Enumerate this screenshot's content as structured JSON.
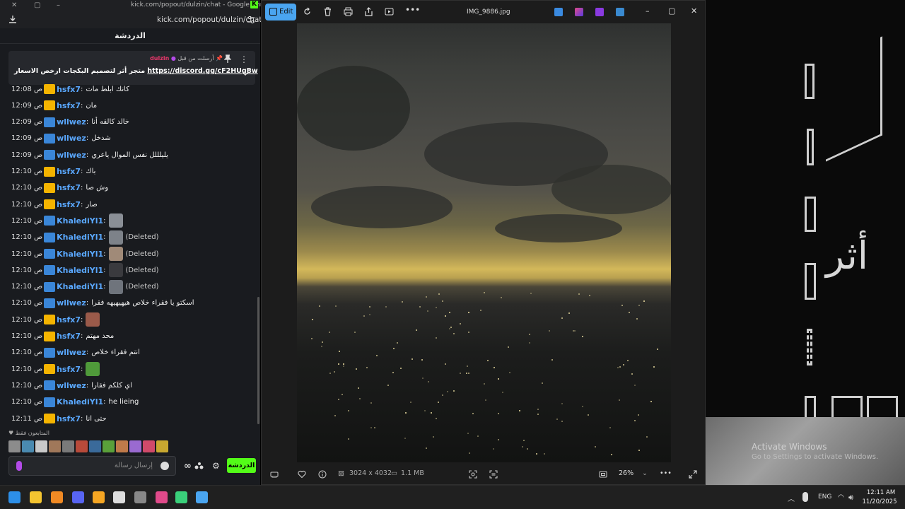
{
  "chrome": {
    "window_title": "kick.com/popout/dulzin/chat - Google Chrome",
    "address": "kick.com/popout/dulzin/chat",
    "logo_letter": "K"
  },
  "chat": {
    "header": "الدردشة",
    "pinned": {
      "author": "dulzin",
      "sent_by_label": "أرسلت من قبل",
      "message_text": "متجر أثر لتصميم البكجات ارخص الاسعار",
      "link": "https://discord.gg/cF2HUgBw"
    },
    "messages": [
      {
        "time": "12:08 ص",
        "user": "hsfx7",
        "badge": "crown",
        "color": "#5aa8ff",
        "text": "كانك ابلط مات",
        "emote": "",
        "deleted": ""
      },
      {
        "time": "12:09 ص",
        "user": "hsfx7",
        "badge": "crown",
        "color": "#5aa8ff",
        "text": "مان",
        "emote": "",
        "deleted": ""
      },
      {
        "time": "12:09 ص",
        "user": "wllwez",
        "badge": "sub",
        "color": "#5aa8ff",
        "text": "خالد كالقه أنا",
        "emote": "",
        "deleted": ""
      },
      {
        "time": "12:09 ص",
        "user": "wllwez",
        "badge": "sub",
        "color": "#5aa8ff",
        "text": "شدخل",
        "emote": "",
        "deleted": ""
      },
      {
        "time": "12:09 ص",
        "user": "wllwez",
        "badge": "sub",
        "color": "#5aa8ff",
        "text": "يليلللل نفس الموال ياعري",
        "emote": "",
        "deleted": ""
      },
      {
        "time": "12:10 ص",
        "user": "hsfx7",
        "badge": "crown",
        "color": "#5aa8ff",
        "text": "باك",
        "emote": "",
        "deleted": ""
      },
      {
        "time": "12:10 ص",
        "user": "hsfx7",
        "badge": "crown",
        "color": "#5aa8ff",
        "text": "وش صا",
        "emote": "",
        "deleted": ""
      },
      {
        "time": "12:10 ص",
        "user": "hsfx7",
        "badge": "crown",
        "color": "#5aa8ff",
        "text": "صار",
        "emote": "",
        "deleted": ""
      },
      {
        "time": "12:10 ص",
        "user": "KhalediYl1",
        "badge": "sub",
        "color": "#5aa8ff",
        "text": "",
        "emote": "#8a8f96",
        "deleted": ""
      },
      {
        "time": "12:10 ص",
        "user": "KhalediYl1",
        "badge": "sub",
        "color": "#5aa8ff",
        "text": "",
        "emote": "#7d8289",
        "deleted": "(Deleted)"
      },
      {
        "time": "12:10 ص",
        "user": "KhalediYl1",
        "badge": "sub",
        "color": "#5aa8ff",
        "text": "",
        "emote": "#a08a78",
        "deleted": "(Deleted)"
      },
      {
        "time": "12:10 ص",
        "user": "KhalediYl1",
        "badge": "sub",
        "color": "#5aa8ff",
        "text": "",
        "emote": "#3a3a3e",
        "deleted": "(Deleted)"
      },
      {
        "time": "12:10 ص",
        "user": "KhalediYl1",
        "badge": "sub",
        "color": "#5aa8ff",
        "text": "",
        "emote": "#6f747c",
        "deleted": "(Deleted)"
      },
      {
        "time": "12:10 ص",
        "user": "wllwez",
        "badge": "sub",
        "color": "#5aa8ff",
        "text": "اسكتو يا فقراء خلاص هيهيهيهه فقرا",
        "emote": "",
        "deleted": ""
      },
      {
        "time": "12:10 ص",
        "user": "hsfx7",
        "badge": "crown",
        "color": "#5aa8ff",
        "text": "",
        "emote": "#9a5a4a",
        "deleted": ""
      },
      {
        "time": "12:10 ص",
        "user": "hsfx7",
        "badge": "crown",
        "color": "#5aa8ff",
        "text": "محد مهتم",
        "emote": "",
        "deleted": ""
      },
      {
        "time": "12:10 ص",
        "user": "wllwez",
        "badge": "sub",
        "color": "#5aa8ff",
        "text": "انتم فقراء خلاص",
        "emote": "",
        "deleted": ""
      },
      {
        "time": "12:10 ص",
        "user": "hsfx7",
        "badge": "crown",
        "color": "#5aa8ff",
        "text": "",
        "emote": "#4f9a3a",
        "deleted": ""
      },
      {
        "time": "12:10 ص",
        "user": "wllwez",
        "badge": "sub",
        "color": "#5aa8ff",
        "text": "اي كلكم فقارا",
        "emote": "",
        "deleted": ""
      },
      {
        "time": "12:10 ص",
        "user": "KhalediYl1",
        "badge": "sub",
        "color": "#5aa8ff",
        "text": "he lieing",
        "emote": "",
        "deleted": ""
      },
      {
        "time": "12:11 ص",
        "user": "hsfx7",
        "badge": "crown",
        "color": "#5aa8ff",
        "text": "حتى انا",
        "emote": "",
        "deleted": ""
      }
    ],
    "recent_emotes_label": "المتابعون فقط",
    "emote_swatches": [
      "#8c8c8c",
      "#4a8ab0",
      "#c9c9c9",
      "#a0785a",
      "#7a7a7a",
      "#b84a3a",
      "#3a6a9a",
      "#5aa03a",
      "#c07a4a",
      "#9a6ad0",
      "#d04a6a",
      "#c8a830"
    ],
    "input_placeholder": "إرسال رسالة",
    "send_label": "الدردشة"
  },
  "photos": {
    "edit_label": "Edit",
    "filename": "IMG_9886.jpg",
    "dimensions": "3024 x 4032",
    "filesize": "1.1 MB",
    "zoom": "26%"
  },
  "desktop": {
    "calligraphy": "أثر",
    "activate_title": "Activate Windows",
    "activate_sub": "Go to Settings to activate Windows."
  },
  "taskbar": {
    "lang": "ENG",
    "time": "12:11 AM",
    "date": "11/20/2025",
    "app_colors": [
      "#2d8fe8",
      "#f4c430",
      "#f08a24",
      "#5865f2",
      "#f5a623",
      "#dddddd",
      "#888888",
      "#e04a8a",
      "#3ad07a",
      "#4aa5f0"
    ]
  }
}
